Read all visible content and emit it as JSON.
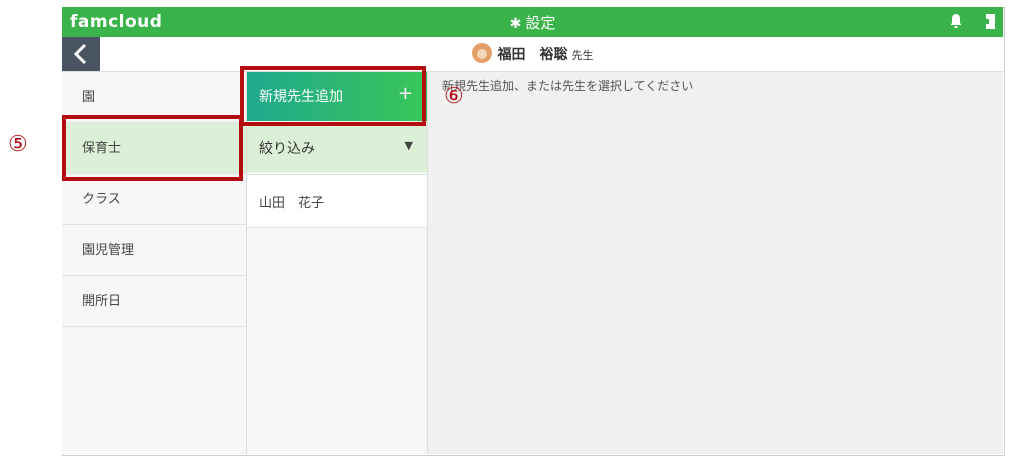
{
  "app": {
    "logo": "famcloud",
    "title": "設定"
  },
  "user": {
    "name": "福田　裕聡",
    "suffix": "先生"
  },
  "sidebar": {
    "items": [
      {
        "label": "園"
      },
      {
        "label": "保育士"
      },
      {
        "label": "クラス"
      },
      {
        "label": "園児管理"
      },
      {
        "label": "開所日"
      }
    ]
  },
  "teachers_panel": {
    "add_label": "新規先生追加",
    "add_icon": "+",
    "filter_label": "絞り込み",
    "teachers": [
      {
        "name": "山田　花子"
      }
    ]
  },
  "main": {
    "hint": "新規先生追加、または先生を選択してください"
  },
  "annotations": {
    "five": "⑤",
    "six": "⑥"
  },
  "colors": {
    "header": "#3ab44a",
    "active": "#dbf0d6",
    "annotation": "#b40d10"
  }
}
